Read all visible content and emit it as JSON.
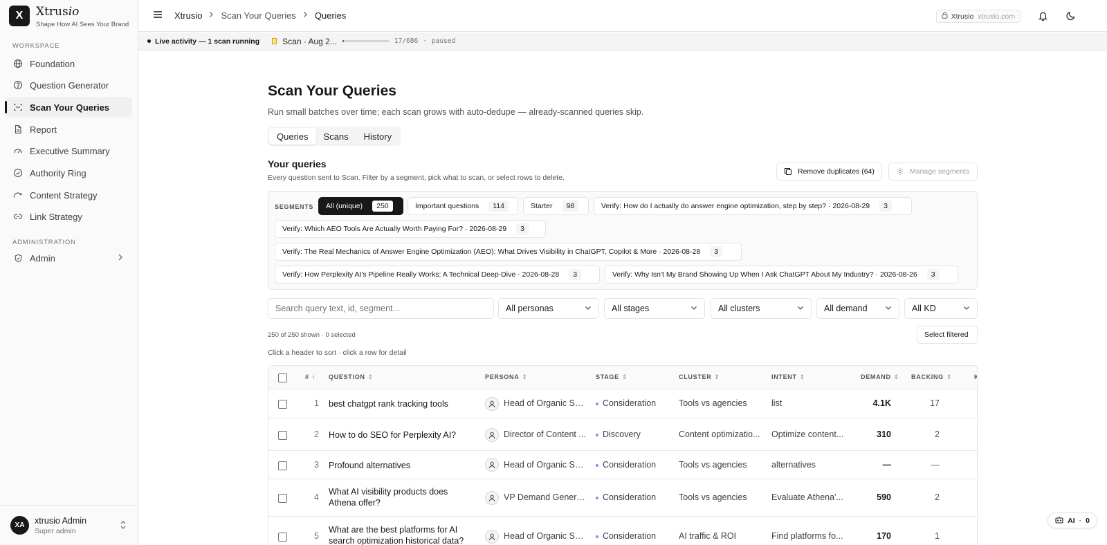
{
  "brand": {
    "logo_letter": "X",
    "name_main": "Xtrus",
    "name_italic": "io",
    "tagline": "Shape How AI Sees Your Brand"
  },
  "sidebar": {
    "workspace_label": "WORKSPACE",
    "items": [
      {
        "label": "Foundation",
        "icon": "globe-icon"
      },
      {
        "label": "Question Generator",
        "icon": "help-circle-icon"
      },
      {
        "label": "Scan Your Queries",
        "icon": "scan-icon",
        "active": true
      },
      {
        "label": "Report",
        "icon": "file-icon"
      },
      {
        "label": "Executive Summary",
        "icon": "gauge-icon"
      },
      {
        "label": "Authority Ring",
        "icon": "check-circle-icon"
      },
      {
        "label": "Content Strategy",
        "icon": "trend-icon"
      },
      {
        "label": "Link Strategy",
        "icon": "link-icon"
      }
    ],
    "admin_label": "ADMINISTRATION",
    "admin_item": "Admin"
  },
  "user": {
    "initials": "XA",
    "name": "xtrusio Admin",
    "role": "Super admin"
  },
  "topbar": {
    "breadcrumbs": [
      "Xtrusio",
      "Scan Your Queries",
      "Queries"
    ],
    "tenant_name": "Xtrusio",
    "tenant_domain": "xtrusio.com"
  },
  "activity": {
    "live_text": "Live activity — 1 scan running",
    "scan_label": "Scan · Aug 2...",
    "progress_fraction": 0.025,
    "progress_text": "17/686",
    "sep": "·",
    "status": "paused"
  },
  "page": {
    "title": "Scan Your Queries",
    "subtitle": "Run small batches over time; each scan grows with auto-dedupe — already-scanned queries skip.",
    "tabs": [
      "Queries",
      "Scans",
      "History"
    ]
  },
  "queries": {
    "title": "Your queries",
    "subtitle": "Every question sent to Scan. Filter by a segment, pick what to scan, or select rows to delete.",
    "remove_duplicates": "Remove duplicates (64)",
    "manage_segments": "Manage segments",
    "segments_label": "SEGMENTS",
    "segments": [
      {
        "label": "All (unique)",
        "count": "250"
      },
      {
        "label": "Important questions",
        "count": "114"
      },
      {
        "label": "Starter",
        "count": "98"
      },
      {
        "label": "Verify: How do I actually do answer engine optimization, step by step? · 2026-08-29",
        "count": "3"
      },
      {
        "label": "Verify: Which AEO Tools Are Actually Worth Paying For? · 2026-08-29",
        "count": "3"
      },
      {
        "label": "Verify: The Real Mechanics of Answer Engine Optimization (AEO): What Drives Visibility in ChatGPT, Copilot & More · 2026-08-28",
        "count": "3"
      },
      {
        "label": "Verify: How Perplexity AI's Pipeline Really Works: A Technical Deep-Dive · 2026-08-28",
        "count": "3"
      },
      {
        "label": "Verify: Why Isn't My Brand Showing Up When I Ask ChatGPT About My Industry? · 2026-08-26",
        "count": "3"
      }
    ],
    "search_placeholder": "Search query text, id, segment...",
    "filters": [
      "All personas",
      "All stages",
      "All clusters",
      "All demand",
      "All KD"
    ],
    "count_text": "250 of 250 shown · 0 selected",
    "select_filtered": "Select filtered",
    "hint": "Click a header to sort · click a row for detail"
  },
  "table": {
    "headers": {
      "num": "#",
      "num_sort": "↑",
      "question": "QUESTION",
      "persona": "PERSONA",
      "stage": "STAGE",
      "cluster": "CLUSTER",
      "intent": "INTENT",
      "demand": "DEMAND",
      "backing": "BACKING",
      "kd": "K"
    },
    "rows": [
      {
        "num": "1",
        "question": "best chatgpt rank tracking tools",
        "persona": "Head of Organic Se...",
        "stage": "Consideration",
        "cluster": "Tools vs agencies",
        "intent": "list",
        "demand": "4.1K",
        "backing": "17"
      },
      {
        "num": "2",
        "question": "How to do SEO for Perplexity AI?",
        "persona": "Director of Content ...",
        "stage": "Discovery",
        "cluster": "Content optimizatio...",
        "intent": "Optimize content...",
        "demand": "310",
        "backing": "2"
      },
      {
        "num": "3",
        "question": "Profound alternatives",
        "persona": "Head of Organic Se...",
        "stage": "Consideration",
        "cluster": "Tools vs agencies",
        "intent": "alternatives",
        "demand": "—",
        "backing": "—"
      },
      {
        "num": "4",
        "question": "What AI visibility products does Athena offer?",
        "persona": "VP Demand Genera...",
        "stage": "Consideration",
        "cluster": "Tools vs agencies",
        "intent": "Evaluate Athena'...",
        "demand": "590",
        "backing": "2"
      },
      {
        "num": "5",
        "question": "What are the best platforms for AI search optimization historical data?",
        "persona": "Head of Organic Se...",
        "stage": "Consideration",
        "cluster": "AI traffic & ROI",
        "intent": "Find platforms fo...",
        "demand": "170",
        "backing": "1"
      }
    ]
  },
  "ai_pill": {
    "label": "AI",
    "sep": "·",
    "count": "0"
  },
  "colors": {
    "accent": "#18181b",
    "stage_dot": "#8b8bf5",
    "border": "#e4e4e7"
  }
}
